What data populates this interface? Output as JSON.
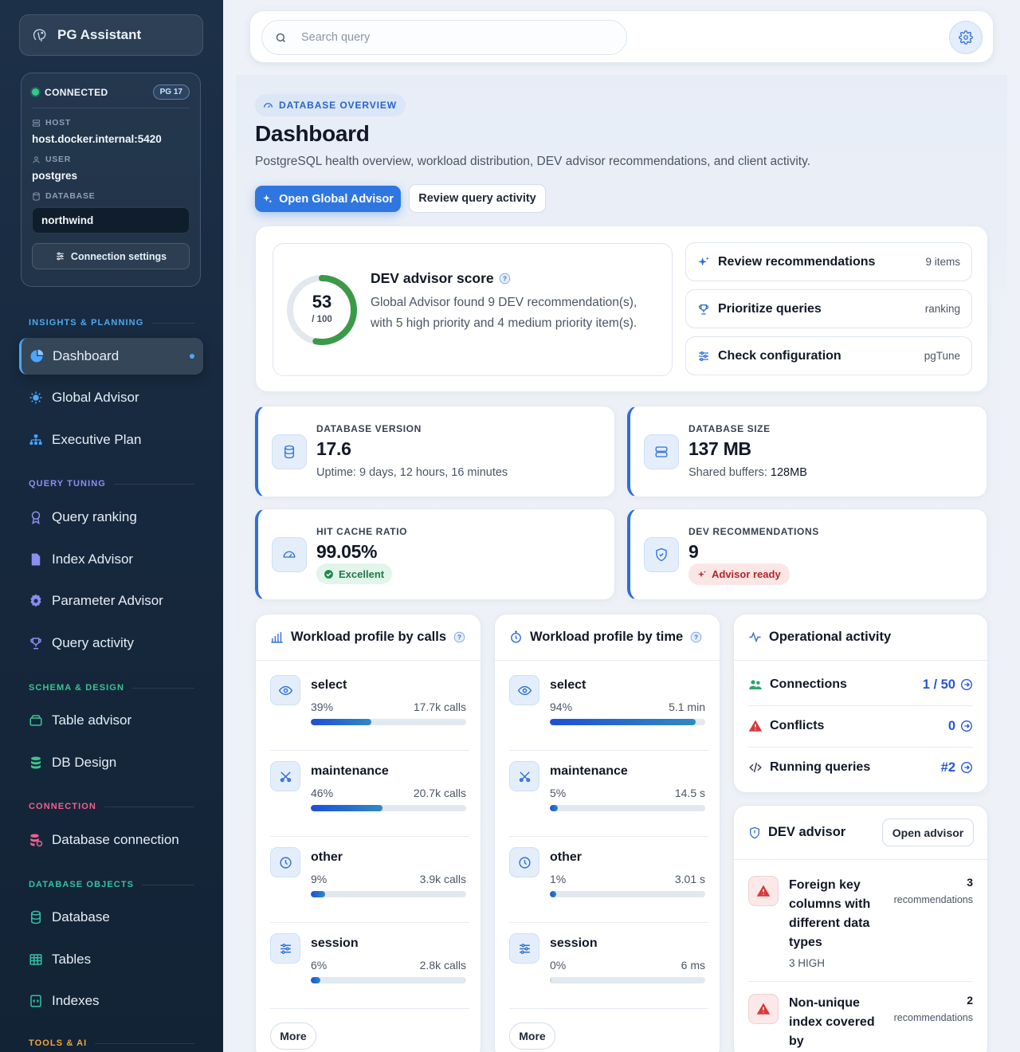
{
  "sidebar": {
    "brand": "PG Assistant",
    "connection": {
      "status": "CONNECTED",
      "version_badge": "PG 17",
      "host_label": "HOST",
      "host": "host.docker.internal:5420",
      "user_label": "USER",
      "user": "postgres",
      "database_label": "DATABASE",
      "database": "northwind",
      "settings_button": "Connection settings"
    },
    "sections": {
      "insights": "INSIGHTS & PLANNING",
      "tuning": "QUERY TUNING",
      "schema": "SCHEMA & DESIGN",
      "connection": "CONNECTION",
      "objects": "DATABASE OBJECTS",
      "tools": "TOOLS & AI"
    },
    "items": {
      "dashboard": "Dashboard",
      "global_advisor": "Global Advisor",
      "executive_plan": "Executive Plan",
      "query_ranking": "Query ranking",
      "index_advisor": "Index Advisor",
      "parameter_advisor": "Parameter Advisor",
      "query_activity": "Query activity",
      "table_advisor": "Table advisor",
      "db_design": "DB Design",
      "database_connection": "Database connection",
      "database": "Database",
      "tables": "Tables",
      "indexes": "Indexes"
    }
  },
  "topbar": {
    "search_placeholder": "Search query"
  },
  "header": {
    "eyebrow": "DATABASE OVERVIEW",
    "title": "Dashboard",
    "subtitle": "PostgreSQL health overview, workload distribution, DEV advisor recommendations, and client activity.",
    "primary_button": "Open Global Advisor",
    "secondary_button": "Review query activity"
  },
  "score": {
    "value": "53",
    "max": "/ 100",
    "fraction": 0.53,
    "title": "DEV advisor score",
    "description": "Global Advisor found 9 DEV recommendation(s), with 5 high priority and 4 medium priority item(s).",
    "actions": [
      {
        "label": "Review recommendations",
        "meta": "9 items"
      },
      {
        "label": "Prioritize queries",
        "meta": "ranking"
      },
      {
        "label": "Check configuration",
        "meta": "pgTune"
      }
    ]
  },
  "kpis": {
    "version": {
      "label": "DATABASE VERSION",
      "value": "17.6",
      "sub": "Uptime: 9 days, 12 hours, 16 minutes"
    },
    "size": {
      "label": "DATABASE SIZE",
      "value": "137 MB",
      "sub_label": "Shared buffers:",
      "sub_value": "128MB"
    },
    "cache": {
      "label": "HIT CACHE RATIO",
      "value": "99.05%",
      "badge": "Excellent"
    },
    "recommendations": {
      "label": "DEV RECOMMENDATIONS",
      "value": "9",
      "badge": "Advisor ready"
    }
  },
  "workload_calls": {
    "title": "Workload profile by calls",
    "items": [
      {
        "name": "select",
        "pct": "39%",
        "value": "17.7k calls",
        "fraction": 0.39
      },
      {
        "name": "maintenance",
        "pct": "46%",
        "value": "20.7k calls",
        "fraction": 0.46
      },
      {
        "name": "other",
        "pct": "9%",
        "value": "3.9k calls",
        "fraction": 0.09
      },
      {
        "name": "session",
        "pct": "6%",
        "value": "2.8k calls",
        "fraction": 0.06
      }
    ],
    "more": "More"
  },
  "workload_time": {
    "title": "Workload profile by time",
    "items": [
      {
        "name": "select",
        "pct": "94%",
        "value": "5.1 min",
        "fraction": 0.94
      },
      {
        "name": "maintenance",
        "pct": "5%",
        "value": "14.5 s",
        "fraction": 0.05
      },
      {
        "name": "other",
        "pct": "1%",
        "value": "3.01 s",
        "fraction": 0.01
      },
      {
        "name": "session",
        "pct": "0%",
        "value": "6 ms",
        "fraction": 0.0
      }
    ],
    "more": "More"
  },
  "operational": {
    "title": "Operational activity",
    "rows": [
      {
        "label": "Connections",
        "value": "1 / 50"
      },
      {
        "label": "Conflicts",
        "value": "0"
      },
      {
        "label": "Running queries",
        "value": "#2"
      }
    ]
  },
  "advisor": {
    "title": "DEV advisor",
    "button": "Open advisor",
    "items": [
      {
        "title": "Foreign key columns with different data types",
        "count": "3",
        "count_label": "recommendations",
        "severity": "3 HIGH"
      },
      {
        "title": "Non-unique index covered by",
        "count": "2",
        "count_label": "recommendations"
      }
    ]
  },
  "colors": {
    "accent": "#2f76e0",
    "sidebar_bg": "#1c3048",
    "score_ring": "#3a9a48",
    "danger": "#d63a3a"
  }
}
